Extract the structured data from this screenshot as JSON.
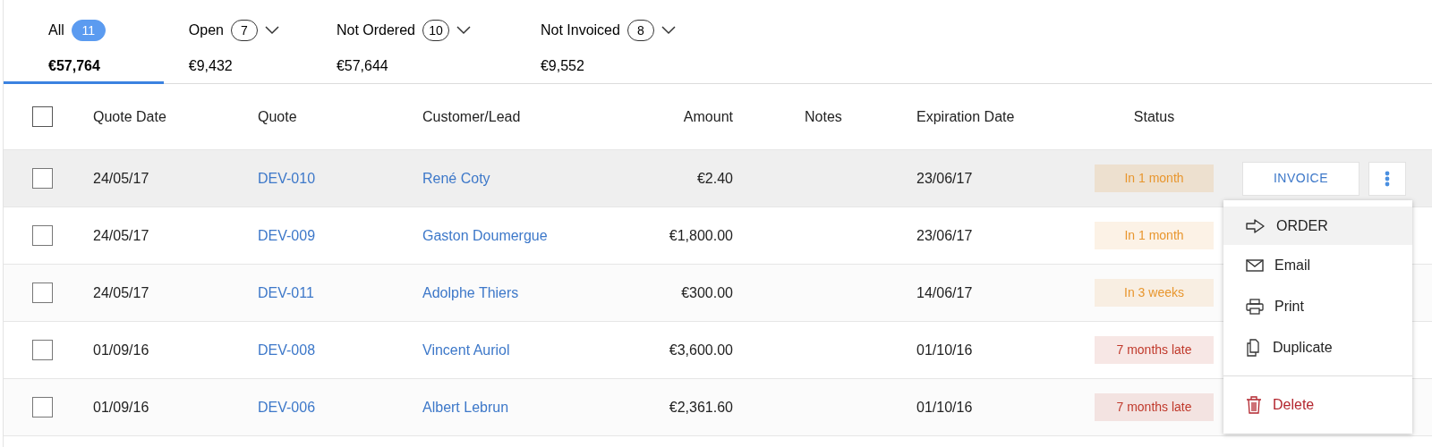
{
  "tabs": [
    {
      "label": "All",
      "count": "11",
      "amount": "€57,764",
      "selected": true,
      "has_menu": false
    },
    {
      "label": "Open",
      "count": "7",
      "amount": "€9,432",
      "selected": false,
      "has_menu": true
    },
    {
      "label": "Not Ordered",
      "count": "10",
      "amount": "€57,644",
      "selected": false,
      "has_menu": true
    },
    {
      "label": "Not Invoiced",
      "count": "8",
      "amount": "€9,552",
      "selected": false,
      "has_menu": true
    }
  ],
  "table": {
    "select_all": {
      "checked": false
    },
    "columns": [
      "Quote Date",
      "Quote",
      "Customer/Lead",
      "Amount",
      "Notes",
      "Expiration Date",
      "Status"
    ],
    "rows": [
      {
        "checked": false,
        "hovered": true,
        "date": "24/05/17",
        "quote": "DEV-010",
        "customer": "René Coty",
        "amount": "€2.40",
        "expiration": "23/06/17",
        "status": "In 1 month",
        "color": "#e8962e"
      },
      {
        "checked": false,
        "hovered": false,
        "date": "24/05/17",
        "quote": "DEV-009",
        "customer": "Gaston Doumergue",
        "amount": "€1,800.00",
        "expiration": "23/06/17",
        "status": "In 1 month",
        "color": "#e8962e"
      },
      {
        "checked": false,
        "hovered": false,
        "date": "24/05/17",
        "quote": "DEV-011",
        "customer": "Adolphe Thiers",
        "amount": "€300.00",
        "expiration": "14/06/17",
        "status": "In 3 weeks",
        "color": "#e8962e"
      },
      {
        "checked": false,
        "hovered": false,
        "date": "01/09/16",
        "quote": "DEV-008",
        "customer": "Vincent Auriol",
        "amount": "€3,600.00",
        "expiration": "01/10/16",
        "status": "7 months late",
        "color": "#c0392b"
      },
      {
        "checked": false,
        "hovered": false,
        "date": "01/09/16",
        "quote": "DEV-006",
        "customer": "Albert Lebrun",
        "amount": "€2,361.60",
        "expiration": "01/10/16",
        "status": "7 months late",
        "color": "#c0392b"
      }
    ]
  },
  "row_actions": {
    "button": "INVOICE",
    "menu": [
      {
        "label": "ORDER",
        "selected": true,
        "kind": "normal"
      },
      {
        "label": "Email",
        "selected": false,
        "kind": "normal"
      },
      {
        "label": "Print",
        "selected": false,
        "kind": "normal"
      },
      {
        "label": "Duplicate",
        "selected": false,
        "kind": "normal"
      },
      {
        "label": "Delete",
        "selected": false,
        "kind": "danger"
      }
    ]
  }
}
